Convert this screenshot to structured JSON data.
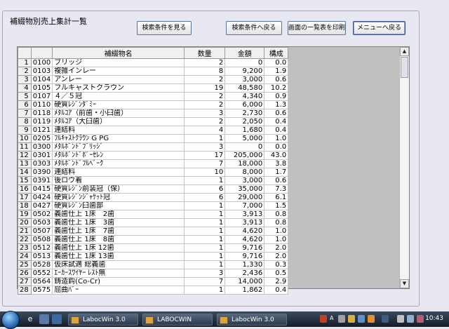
{
  "frame": {
    "title": "補綴物別売上集計一覧"
  },
  "buttons": {
    "view_conditions": "検索条件を見る",
    "back_to_conditions": "検索条件へ戻る",
    "print_list": "画面の一覧表を印刷",
    "back_to_menu": "メニューへ戻る"
  },
  "table": {
    "headers": [
      "",
      "",
      "補綴物名",
      "数量",
      "金額",
      "構成"
    ],
    "rows": [
      [
        "1",
        "0100",
        "ブリッジ",
        "2",
        "0",
        "0.0"
      ],
      [
        "2",
        "0103",
        "複雑インレー",
        "8",
        "9,200",
        "1.9"
      ],
      [
        "3",
        "0104",
        "アンレー",
        "2",
        "3,000",
        "0.6"
      ],
      [
        "4",
        "0105",
        "フルキャストクラウン",
        "19",
        "48,580",
        "10.2"
      ],
      [
        "5",
        "0107",
        "４／５冠",
        "2",
        "4,340",
        "0.9"
      ],
      [
        "6",
        "0110",
        "硬質ﾚｼﾞﾝﾀﾞﾐｰ",
        "2",
        "6,000",
        "1.3"
      ],
      [
        "7",
        "0118",
        "ﾒﾀﾙｺｱ（前歯・小臼歯）",
        "3",
        "2,730",
        "0.6"
      ],
      [
        "8",
        "0119",
        "ﾒﾀﾙｺｱ（大臼歯）",
        "2",
        "2,050",
        "0.4"
      ],
      [
        "9",
        "0121",
        "連結料",
        "4",
        "1,680",
        "0.4"
      ],
      [
        "10",
        "0205",
        "ﾌﾙｷｬｽﾄｸﾗｳﾝ G PG",
        "1",
        "5,000",
        "1.0"
      ],
      [
        "11",
        "0300",
        "ﾒﾀﾙﾎﾞﾝﾄﾞﾌﾞﾘｯｼﾞ",
        "3",
        "0",
        "0.0"
      ],
      [
        "12",
        "0301",
        "ﾒﾀﾙﾎﾞﾝﾄﾞﾎﾟｰｾﾚﾝ",
        "17",
        "205,000",
        "43.0"
      ],
      [
        "13",
        "0303",
        "ﾒﾀﾙﾎﾞﾝﾄﾞﾌﾙﾍﾞｰｸ",
        "7",
        "18,000",
        "3.8"
      ],
      [
        "14",
        "0390",
        "連結料",
        "10",
        "8,000",
        "1.7"
      ],
      [
        "15",
        "0391",
        "後ロウ着",
        "1",
        "3,000",
        "0.6"
      ],
      [
        "16",
        "0415",
        "硬質ﾚｼﾞﾝ前装冠（保）",
        "6",
        "35,000",
        "7.3"
      ],
      [
        "17",
        "0424",
        "硬質ﾚｼﾞﾝｼﾞｬｹｯﾄ冠",
        "6",
        "29,000",
        "6.1"
      ],
      [
        "18",
        "0427",
        "硬質ﾚｼﾞﾝ臼歯部",
        "1",
        "7,000",
        "1.5"
      ],
      [
        "19",
        "0502",
        "義歯仕上 1床　2歯",
        "1",
        "3,913",
        "0.8"
      ],
      [
        "20",
        "0503",
        "義歯仕上 1床　3歯",
        "1",
        "3,913",
        "0.8"
      ],
      [
        "21",
        "0507",
        "義歯仕上 1床　7歯",
        "1",
        "4,620",
        "1.0"
      ],
      [
        "22",
        "0508",
        "義歯仕上 1床　8歯",
        "1",
        "4,620",
        "1.0"
      ],
      [
        "23",
        "0512",
        "義歯仕上 1床 12歯",
        "1",
        "9,716",
        "2.0"
      ],
      [
        "24",
        "0513",
        "義歯仕上 1床 13歯",
        "1",
        "9,716",
        "2.0"
      ],
      [
        "25",
        "0528",
        "仮床試適 総義歯",
        "1",
        "1,330",
        "0.3"
      ],
      [
        "26",
        "0552",
        "ｴｰｶｰｽﾜｲﾔｰ ﾚｽﾄ無",
        "3",
        "2,436",
        "0.5"
      ],
      [
        "27",
        "0564",
        "鋳造鈎(Co-Cr)",
        "7",
        "14,000",
        "2.9"
      ],
      [
        "28",
        "0575",
        "屈曲ﾊﾞｰ",
        "1",
        "1,862",
        "0.4"
      ]
    ]
  },
  "taskbar": {
    "tasks": [
      "LabocWin 3.0",
      "LABOCWIN",
      "LabocWin 3.0"
    ],
    "tray_text_a": "A",
    "clock": "10:43"
  }
}
